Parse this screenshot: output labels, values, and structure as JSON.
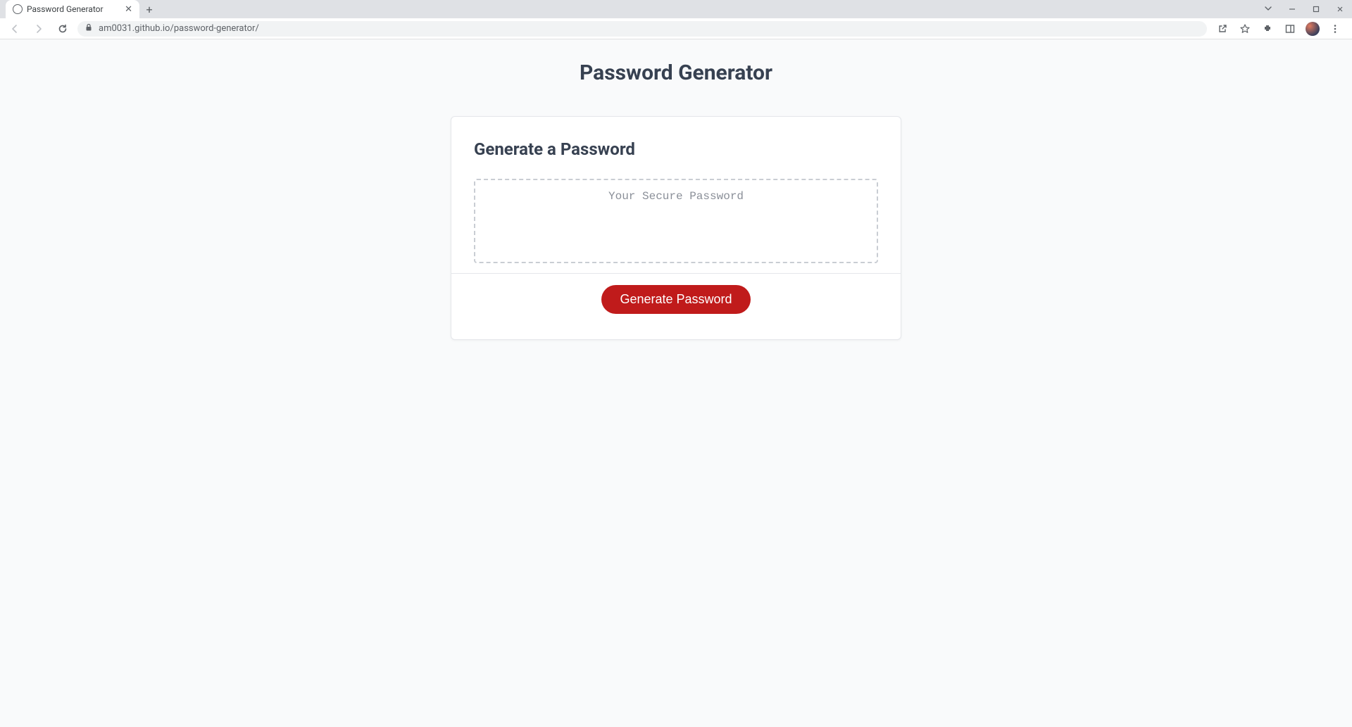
{
  "browser": {
    "tab_title": "Password Generator",
    "url": "am0031.github.io/password-generator/"
  },
  "page": {
    "title": "Password Generator",
    "card_title": "Generate a Password",
    "password_placeholder": "Your Secure Password",
    "password_value": "",
    "generate_button_label": "Generate Password"
  }
}
